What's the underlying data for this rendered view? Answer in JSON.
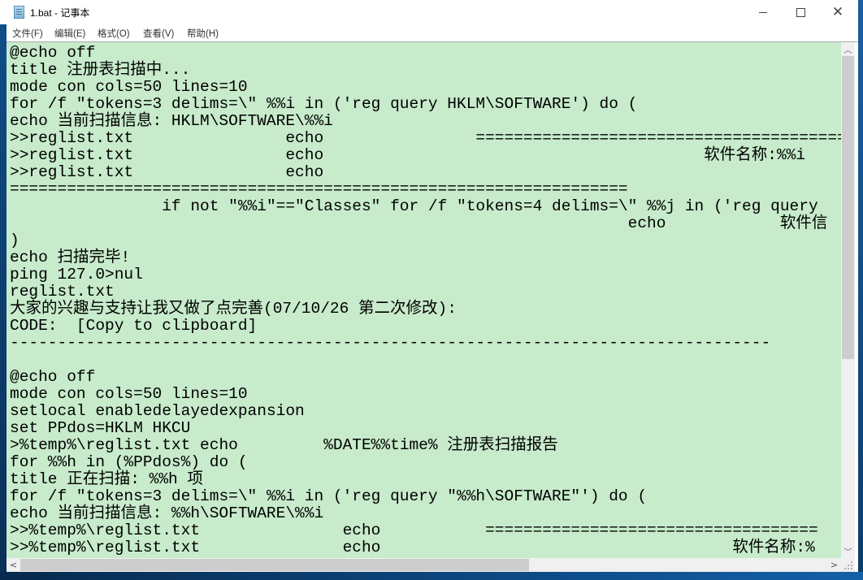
{
  "window": {
    "title": "1.bat - 记事本",
    "controls": {
      "minimize": "minimize",
      "maximize": "maximize",
      "close": "close"
    }
  },
  "menu": {
    "items": [
      {
        "label": "文件(F)"
      },
      {
        "label": "编辑(E)"
      },
      {
        "label": "格式(O)"
      },
      {
        "label": "查看(V)"
      },
      {
        "label": "帮助(H)"
      }
    ]
  },
  "editor": {
    "background_color": "#c7ebcb",
    "lines": [
      "@echo off",
      "title 注册表扫描中...",
      "mode con cols=50 lines=10",
      "for /f \"tokens=3 delims=\\\" %%i in ('reg query HKLM\\SOFTWARE') do (",
      "echo 当前扫描信息: HKLM\\SOFTWARE\\%%i",
      ">>reglist.txt                echo                ========================================",
      ">>reglist.txt                echo                                        软件名称:%%i",
      ">>reglist.txt                echo",
      "=================================================================",
      "                if not \"%%i\"==\"Classes\" for /f \"tokens=4 delims=\\\" %%j in ('reg query",
      "                                                                 echo            软件信",
      ")",
      "echo 扫描完毕!",
      "ping 127.0>nul",
      "reglist.txt",
      "大家的兴趣与支持让我又做了点完善(07/10/26 第二次修改):",
      "CODE:  [Copy to clipboard]",
      "--------------------------------------------------------------------------------",
      "",
      "@echo off",
      "mode con cols=50 lines=10",
      "setlocal enabledelayedexpansion",
      "set PPdos=HKLM HKCU",
      ">%temp%\\reglist.txt echo         %DATE%%time% 注册表扫描报告",
      "for %%h in (%PPdos%) do (",
      "title 正在扫描: %%h 项",
      "for /f \"tokens=3 delims=\\\" %%i in ('reg query \"%%h\\SOFTWARE\"') do (",
      "echo 当前扫描信息: %%h\\SOFTWARE\\%%i",
      ">>%temp%\\reglist.txt               echo           ===================================",
      ">>%temp%\\reglist.txt               echo                                     软件名称:%"
    ]
  },
  "scrollbars": {
    "vertical": {
      "up_arrow": "▲",
      "down_arrow": "▼",
      "position_fraction": 0.0,
      "visible_fraction": 0.62
    },
    "horizontal": {
      "left_arrow": "<",
      "right_arrow": ">",
      "position_fraction": 0.0,
      "visible_fraction": 0.63
    }
  }
}
